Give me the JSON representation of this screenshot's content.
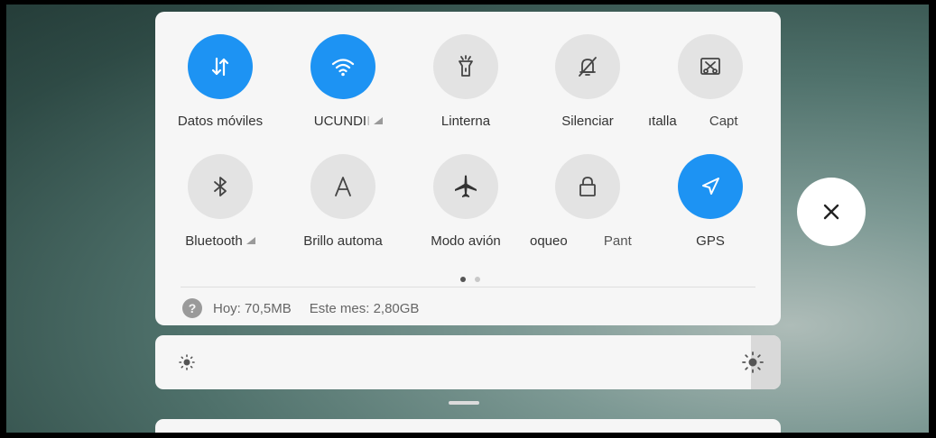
{
  "tiles_row1": [
    {
      "label": "Datos móviles",
      "icon": "mobile-data-icon",
      "active": true
    },
    {
      "label": "UCUNDI",
      "icon": "wifi-icon",
      "active": true,
      "has_menu": true
    },
    {
      "label": "Linterna",
      "icon": "flashlight-icon",
      "active": false
    },
    {
      "label": "Silenciar",
      "icon": "bell-off-icon",
      "active": false
    },
    {
      "label": "ıtalla",
      "label2": "Capt",
      "icon": "screenshot-icon",
      "active": false
    }
  ],
  "tiles_row2": [
    {
      "label": "Bluetooth",
      "icon": "bluetooth-icon",
      "active": false,
      "has_menu": true
    },
    {
      "label": "Brillo automa",
      "icon": "auto-brightness-icon",
      "active": false
    },
    {
      "label": "Modo avión",
      "icon": "airplane-icon",
      "active": false
    },
    {
      "label": "oqueo",
      "label2": "Pant",
      "icon": "lock-icon",
      "active": false
    },
    {
      "label": "GPS",
      "icon": "location-arrow-icon",
      "active": true
    }
  ],
  "page_indicator": {
    "current": 1,
    "total": 2
  },
  "data_usage": {
    "icon": "help-icon",
    "today": "Hoy: 70,5MB",
    "month": "Este mes: 2,80GB"
  },
  "brightness": {
    "level": 0.95
  },
  "colors": {
    "accent": "#1D93F3",
    "tile_inactive": "#E3E3E3",
    "panel": "#F6F6F6"
  }
}
